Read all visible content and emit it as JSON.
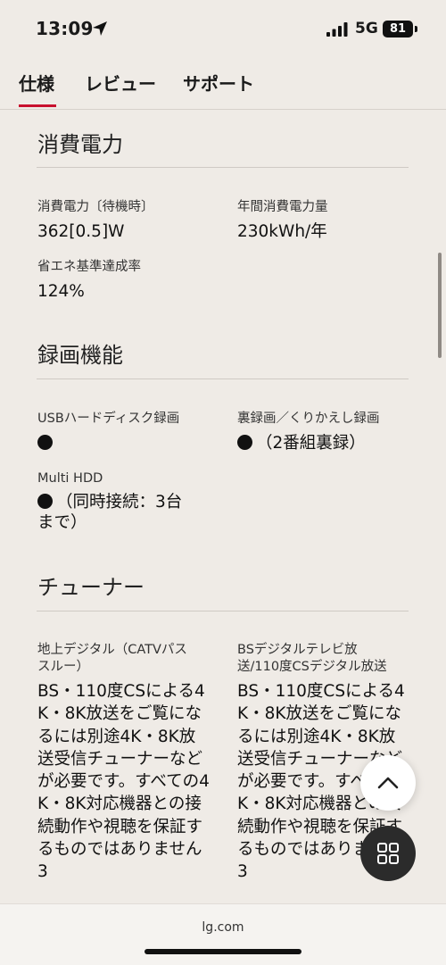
{
  "status": {
    "time": "13:09",
    "network": "5G",
    "battery": "81"
  },
  "tabs": [
    {
      "label": "仕様",
      "active": true
    },
    {
      "label": "レビュー",
      "active": false
    },
    {
      "label": "サポート",
      "active": false
    }
  ],
  "sections": {
    "power": {
      "title": "消費電力",
      "standby_label": "消費電力〔待機時〕",
      "standby_value": "362[0.5]W",
      "annual_label": "年間消費電力量",
      "annual_value": "230kWh/年",
      "saving_label": "省エネ基準達成率",
      "saving_value": "124%"
    },
    "recording": {
      "title": "録画機能",
      "usb_label": "USBハードディスク録画",
      "back_label": "裏録画／くりかえし録画",
      "back_value": "（2番組裏録）",
      "multi_label": "Multi HDD",
      "multi_value_1": "（同時接続：3台",
      "multi_value_2": "まで）"
    },
    "tuner": {
      "title": "チューナー",
      "terrestrial_label_1": "地上デジタル（CATVパス",
      "terrestrial_label_2": "スルー）",
      "bs_label_1": "BSデジタルテレビ放",
      "bs_label_2": "送/110度CSデジタル放送",
      "note_text": "BS・110度CSによる4K・8K放送をご覧になるには別途4K・8K放送受信チューナーなどが必要です。すべての4K・8K対応機器との接続動作や視聴を保証するものではありません3"
    }
  },
  "footer": {
    "url": "lg.com"
  },
  "colors": {
    "background": "#efebe6",
    "accent": "#c8102e"
  }
}
